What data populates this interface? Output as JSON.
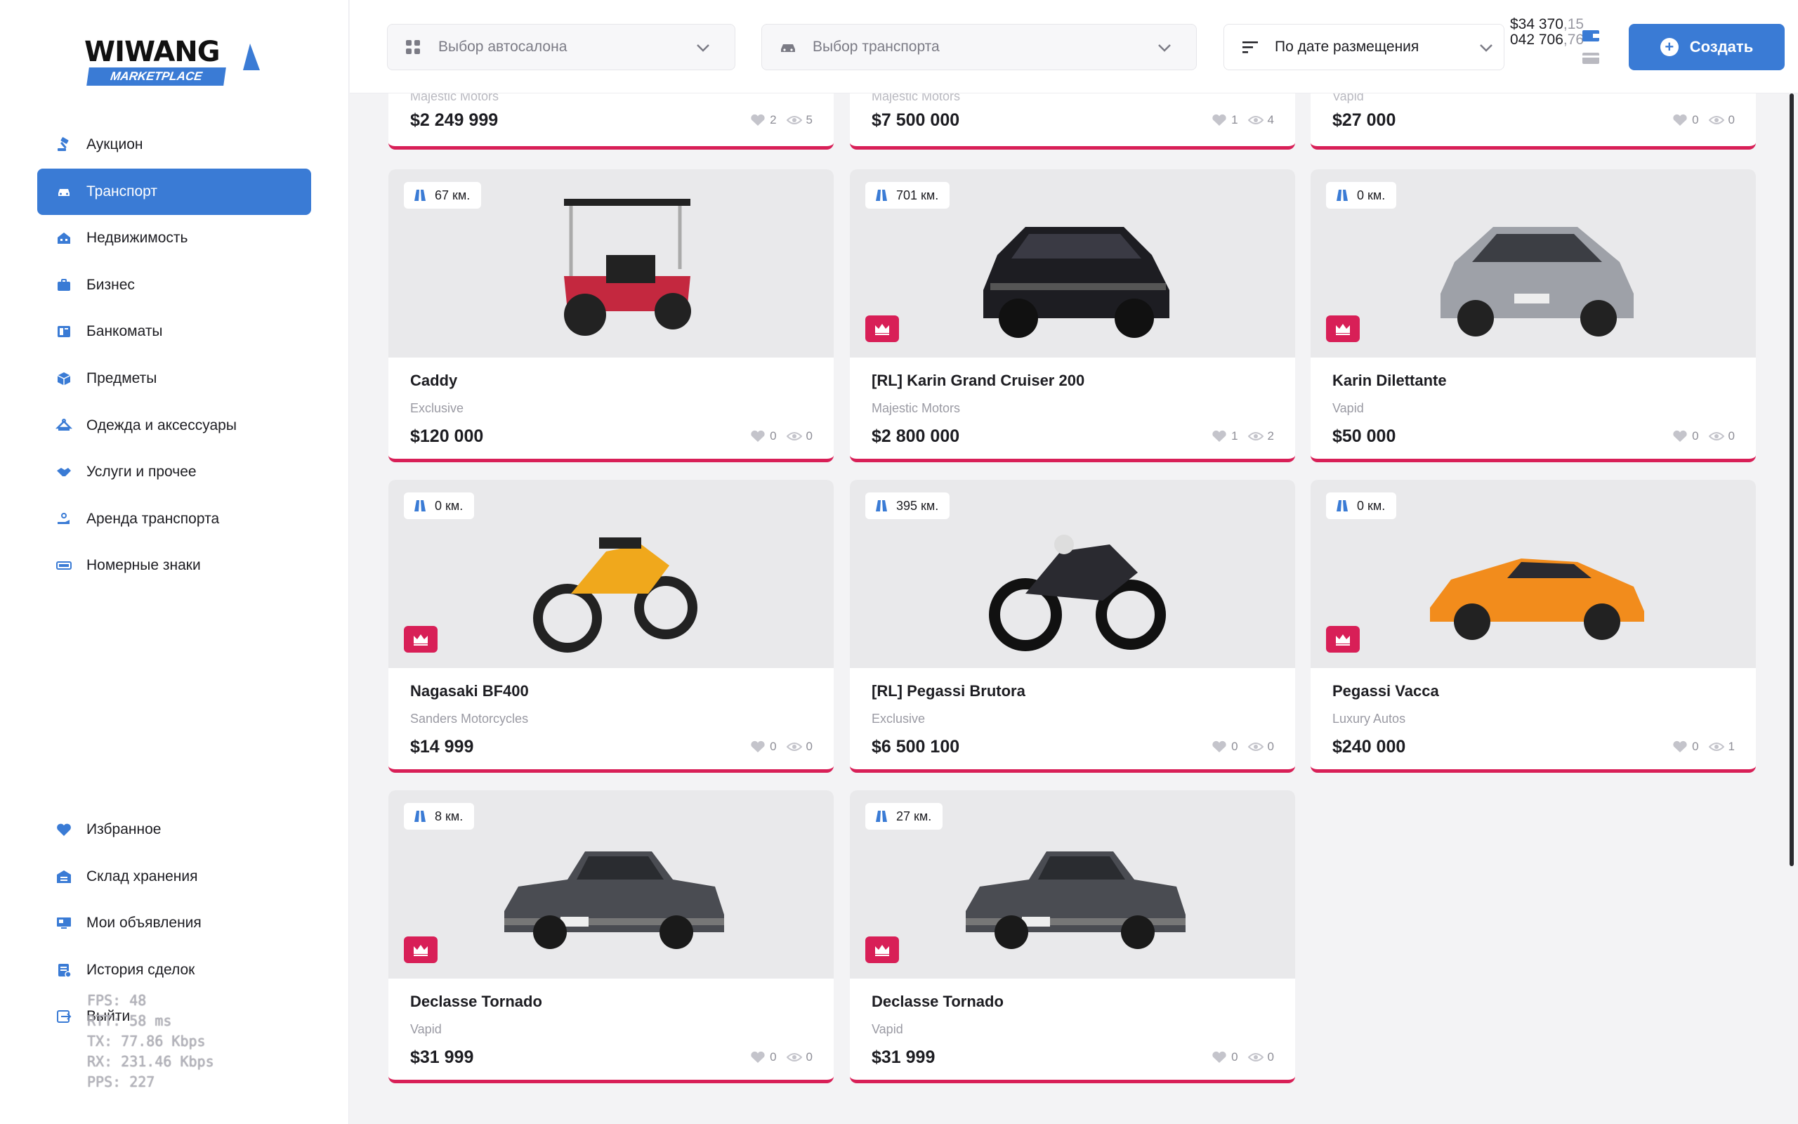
{
  "sidebar": {
    "logo": {
      "brand": "WIWANG",
      "sub": "MARKETPLACE"
    },
    "items": [
      {
        "label": "Аукцион",
        "icon": "gavel-icon",
        "active": false
      },
      {
        "label": "Транспорт",
        "icon": "car-icon",
        "active": true
      },
      {
        "label": "Недвижимость",
        "icon": "house-icon",
        "active": false
      },
      {
        "label": "Бизнес",
        "icon": "briefcase-icon",
        "active": false
      },
      {
        "label": "Банкоматы",
        "icon": "atm-icon",
        "active": false
      },
      {
        "label": "Предметы",
        "icon": "box-icon",
        "active": false
      },
      {
        "label": "Одежда и аксессуары",
        "icon": "hanger-icon",
        "active": false
      },
      {
        "label": "Услуги и прочее",
        "icon": "handshake-icon",
        "active": false
      },
      {
        "label": "Аренда транспорта",
        "icon": "key-hand-icon",
        "active": false
      },
      {
        "label": "Номерные знаки",
        "icon": "plate-icon",
        "active": false
      }
    ],
    "bottom_items": [
      {
        "label": "Избранное",
        "icon": "heart-icon"
      },
      {
        "label": "Склад хранения",
        "icon": "warehouse-icon"
      },
      {
        "label": "Мои объявления",
        "icon": "listing-icon"
      },
      {
        "label": "История сделок",
        "icon": "history-icon"
      },
      {
        "label": "Выйти",
        "icon": "logout-icon"
      }
    ]
  },
  "overlay": {
    "lines": [
      "FPS:   48",
      "RTT:   58 ms",
      "TX:    77.86 Kbps",
      "RX:    231.46 Kbps",
      "PPS:   227"
    ]
  },
  "topbar": {
    "dealership_placeholder": "Выбор автосалона",
    "vehicle_placeholder": "Выбор транспорта",
    "sort_label": "По дате размещения",
    "balance_cash": "$34 370",
    "balance_cash_frac": ",15",
    "balance_bank": "042 706",
    "balance_bank_frac": ",76",
    "create_label": "Создать"
  },
  "partials": [
    {
      "dealer": "Majestic Motors",
      "price": "$2 249 999",
      "likes": "2",
      "views": "5"
    },
    {
      "dealer": "Majestic Motors",
      "price": "$7 500 000",
      "likes": "1",
      "views": "4"
    },
    {
      "dealer": "Vapid",
      "price": "$27 000",
      "likes": "0",
      "views": "0"
    }
  ],
  "listings": [
    {
      "km": "67 км.",
      "title": "Caddy",
      "dealer": "Exclusive",
      "price": "$120 000",
      "likes": "0",
      "views": "0",
      "premium": false,
      "vehicle": "golf-cart"
    },
    {
      "km": "701 км.",
      "title": "[RL] Karin Grand Cruiser 200",
      "dealer": "Majestic Motors",
      "price": "$2 800 000",
      "likes": "1",
      "views": "2",
      "premium": true,
      "vehicle": "suv"
    },
    {
      "km": "0 км.",
      "title": "Karin Dilettante",
      "dealer": "Vapid",
      "price": "$50 000",
      "likes": "0",
      "views": "0",
      "premium": true,
      "vehicle": "hatchback"
    },
    {
      "km": "0 км.",
      "title": "Nagasaki BF400",
      "dealer": "Sanders Motorcycles",
      "price": "$14 999",
      "likes": "0",
      "views": "0",
      "premium": true,
      "vehicle": "dirtbike"
    },
    {
      "km": "395 км.",
      "title": "[RL] Pegassi Brutora",
      "dealer": "Exclusive",
      "price": "$6 500 100",
      "likes": "0",
      "views": "0",
      "premium": false,
      "vehicle": "motorcycle"
    },
    {
      "km": "0 км.",
      "title": "Pegassi Vacca",
      "dealer": "Luxury Autos",
      "price": "$240 000",
      "likes": "0",
      "views": "1",
      "premium": true,
      "vehicle": "supercar"
    },
    {
      "km": "8 км.",
      "title": "Declasse Tornado",
      "dealer": "Vapid",
      "price": "$31 999",
      "likes": "0",
      "views": "0",
      "premium": true,
      "vehicle": "classic"
    },
    {
      "km": "27 км.",
      "title": "Declasse Tornado",
      "dealer": "Vapid",
      "price": "$31 999",
      "likes": "0",
      "views": "0",
      "premium": true,
      "vehicle": "classic"
    }
  ],
  "colors": {
    "accent": "#3a7bd5",
    "premium": "#d81f57",
    "card_bg": "#e9e9eb"
  }
}
